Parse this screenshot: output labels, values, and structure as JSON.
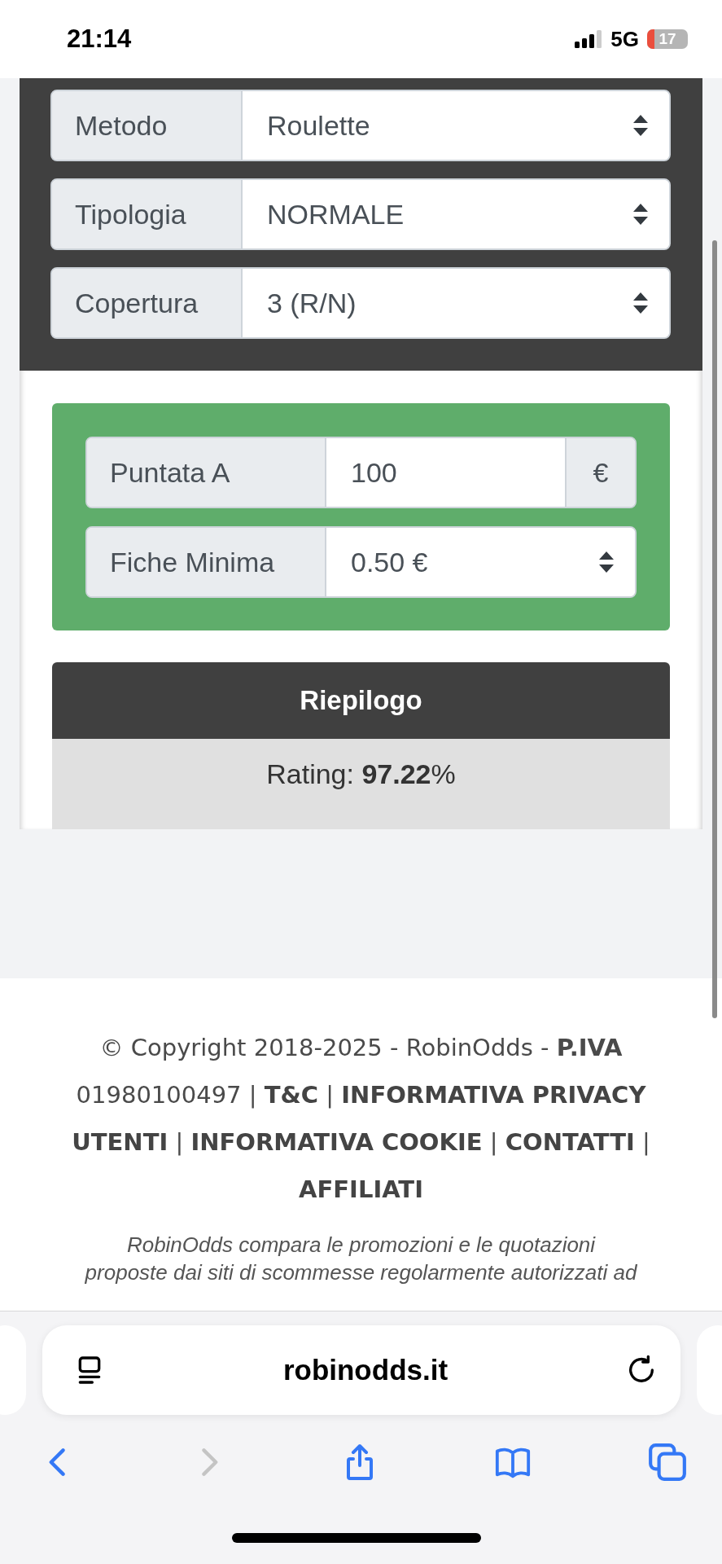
{
  "status_bar": {
    "time": "21:14",
    "network": "5G",
    "battery": "17"
  },
  "settings": [
    {
      "label": "Metodo",
      "value": "Roulette"
    },
    {
      "label": "Tipologia",
      "value": "NORMALE"
    },
    {
      "label": "Copertura",
      "value": "3 (R/N)"
    }
  ],
  "stake_panel": [
    {
      "kind": "input",
      "label": "Puntata A",
      "value": "100",
      "suffix": "€"
    },
    {
      "kind": "select",
      "label": "Fiche Minima",
      "value": "0.50 €"
    }
  ],
  "summary": {
    "title": "Riepilogo",
    "rating": "Rating: **97.22**%"
  },
  "footer": {
    "copyright": [
      {
        "kind": "text",
        "text": "© Copyright 2018-2025 - RobinOdds - "
      },
      {
        "kind": "bold",
        "text": "P.IVA"
      },
      {
        "kind": "text",
        "text": " 01980100497 | "
      },
      {
        "kind": "link",
        "text": "T&C"
      },
      {
        "kind": "text",
        "text": " | "
      },
      {
        "kind": "link",
        "text": "INFORMATIVA PRIVACY UTENTI"
      },
      {
        "kind": "text",
        "text": " | "
      },
      {
        "kind": "link",
        "text": "INFORMATIVA COOKIE"
      },
      {
        "kind": "text",
        "text": " | "
      },
      {
        "kind": "link",
        "text": "CONTATTI"
      },
      {
        "kind": "text",
        "text": " | "
      },
      {
        "kind": "link",
        "text": "AFFILIATI"
      }
    ],
    "disclaimer": [
      "RobinOdds compara le promozioni e le quotazioni",
      "proposte dai siti di scommesse regolarmente autorizzati ad"
    ]
  },
  "browser": {
    "url": "robinodds.it",
    "forward_disabled": true
  }
}
